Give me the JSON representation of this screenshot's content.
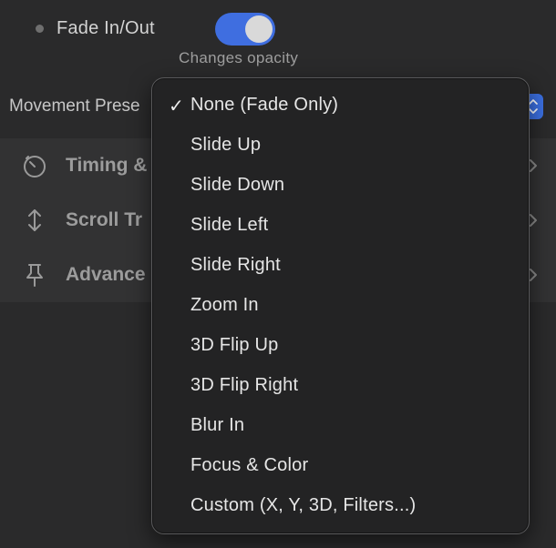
{
  "fade": {
    "label": "Fade In/Out",
    "enabled": true,
    "caption": "Changes opacity"
  },
  "movement": {
    "label": "Movement Prese"
  },
  "sections": [
    {
      "label": "Timing &",
      "icon": "timer-icon"
    },
    {
      "label": "Scroll Tr",
      "icon": "up-down-arrows-icon"
    },
    {
      "label": "Advance",
      "icon": "pin-icon"
    }
  ],
  "menu": {
    "selected_index": 0,
    "check_glyph": "✓",
    "items": [
      "None (Fade Only)",
      "Slide Up",
      "Slide Down",
      "Slide Left",
      "Slide Right",
      "Zoom In",
      "3D Flip Up",
      "3D Flip Right",
      "Blur In",
      "Focus & Color",
      "Custom (X, Y, 3D, Filters...)"
    ]
  },
  "colors": {
    "accent": "#3f6ee0",
    "background": "#2a2a2b",
    "menu_bg": "#232324"
  }
}
